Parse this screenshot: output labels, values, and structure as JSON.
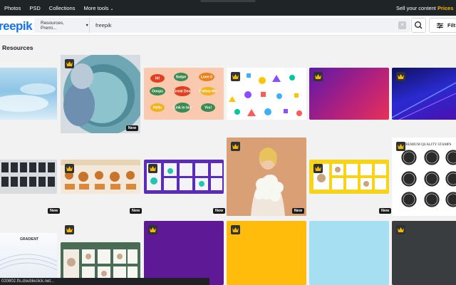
{
  "topnav": {
    "items": [
      "Photos",
      "PSD",
      "Collections",
      "More tools"
    ],
    "sell_label": "Sell your content",
    "prices_label": "Prices"
  },
  "header": {
    "logo_text": "reepik",
    "search_filter": "Resources, Premi...",
    "search_value": "freepik",
    "filters_label": "Filt"
  },
  "section": {
    "title": "Resources"
  },
  "badges": {
    "new": "New"
  },
  "colors": {
    "accent": "#1273eb",
    "crown": "#f7b500",
    "topbar": "#1f2426"
  },
  "thumbnails": {
    "stickers": [
      "Hi!",
      "Swipe",
      "Love it",
      "Ooops",
      "Great Deal",
      "Follow Me",
      "Hello",
      "Link in bio",
      "Yes!"
    ],
    "stamps_title": "PREMIUM QUALITY STAMPS",
    "gradient_title": "GRADIENT"
  },
  "statusbar": {
    "text": "020802.fls.doubleclick.net..."
  }
}
